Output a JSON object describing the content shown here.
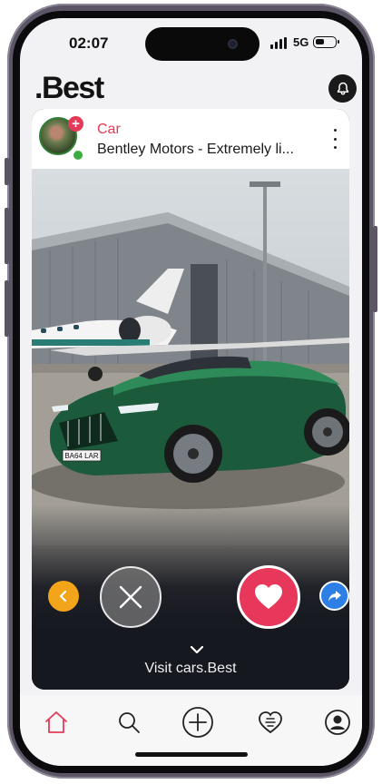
{
  "status_bar": {
    "time": "02:07",
    "network": "5G",
    "icons": [
      "signal-icon",
      "battery-icon"
    ]
  },
  "header": {
    "logo": ".Best",
    "notification_icon": "bell-icon"
  },
  "post": {
    "category": "Car",
    "title": "Bentley Motors - Extremely li...",
    "avatar_icon": "avatar",
    "follow_icon": "plus-icon",
    "more_icon": "more-vertical-icon",
    "image_plate_text": "BA64 LAR",
    "actions": {
      "back_icon": "chevron-left-icon",
      "dislike_icon": "close-icon",
      "like_icon": "heart-icon",
      "share_icon": "share-arrow-icon"
    },
    "visit_label": "Visit cars.Best"
  },
  "tab_bar": {
    "items": [
      "home-icon",
      "search-icon",
      "add-icon",
      "favorites-icon",
      "profile-icon"
    ],
    "active": "home-icon"
  },
  "colors": {
    "accent": "#e33a57",
    "back_button": "#f2a41a",
    "share_button": "#2d7fe6",
    "car_green": "#1c5a3c"
  }
}
